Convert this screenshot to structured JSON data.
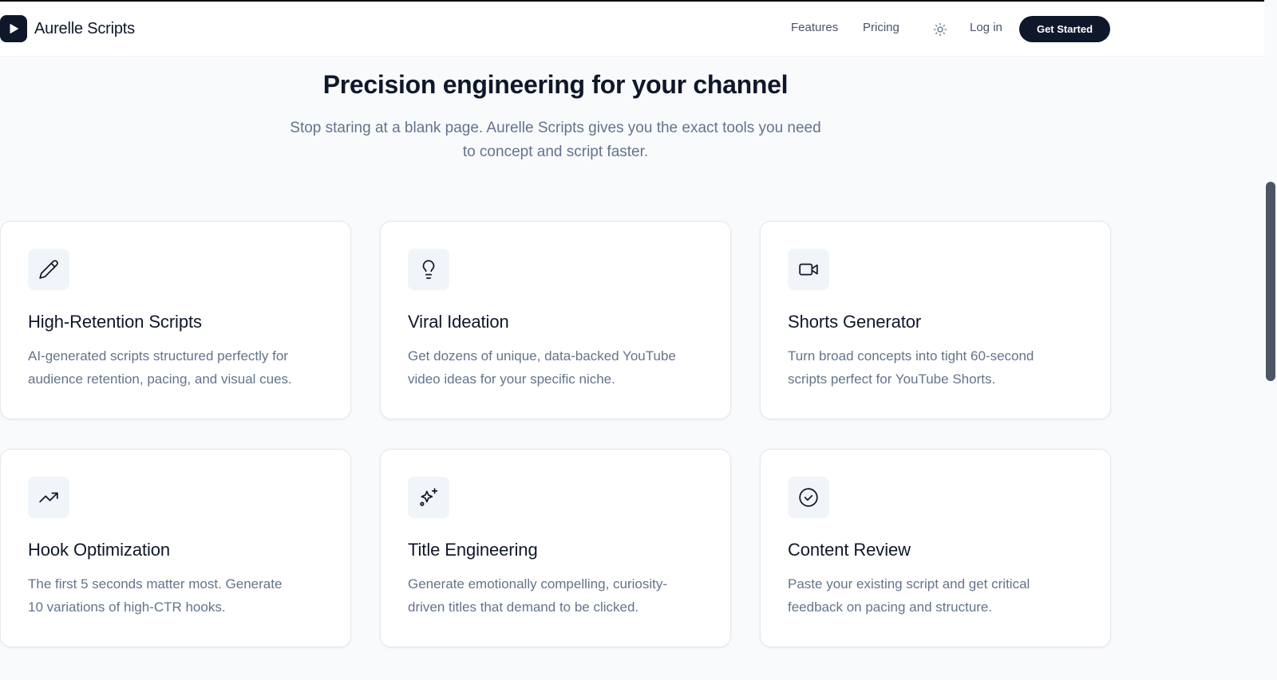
{
  "nav": {
    "brand": "Aurelle Scripts",
    "links": [
      {
        "label": "Features"
      },
      {
        "label": "Pricing"
      }
    ],
    "theme_icon": "sun-icon",
    "login": "Log in",
    "cta": "Get Started"
  },
  "section": {
    "title": "Precision engineering for your channel",
    "subtitle_line1": "Stop staring at a blank page. Aurelle Scripts gives you the exact tools you need",
    "subtitle_line2": "to concept and script faster."
  },
  "cards": [
    {
      "icon": "pencil-icon",
      "title": "High-Retention Scripts",
      "desc_line1": "AI-generated scripts structured perfectly for",
      "desc_line2": "audience retention, pacing, and visual cues."
    },
    {
      "icon": "lightbulb-icon",
      "title": "Viral Ideation",
      "desc_line1": "Get dozens of unique, data-backed YouTube",
      "desc_line2": "video ideas for your specific niche."
    },
    {
      "icon": "video-icon",
      "title": "Shorts Generator",
      "desc_line1": "Turn broad concepts into tight 60-second",
      "desc_line2": "scripts perfect for YouTube Shorts."
    },
    {
      "icon": "trending-up-icon",
      "title": "Hook Optimization",
      "desc_line1": "The first 5 seconds matter most. Generate",
      "desc_line2": "10 variations of high-CTR hooks."
    },
    {
      "icon": "sparkles-icon",
      "title": "Title Engineering",
      "desc_line1": "Generate emotionally compelling, curiosity-",
      "desc_line2": "driven titles that demand to be clicked."
    },
    {
      "icon": "check-circle-icon",
      "title": "Content Review",
      "desc_line1": "Paste your existing script and get critical",
      "desc_line2": "feedback on pacing and structure."
    }
  ],
  "colors": {
    "primary": "#0f172a",
    "muted_text": "#64748b",
    "nav_text": "#475569",
    "page_bg": "#f8fafc",
    "card_bg": "#ffffff",
    "icon_bg": "#f1f5f9"
  }
}
